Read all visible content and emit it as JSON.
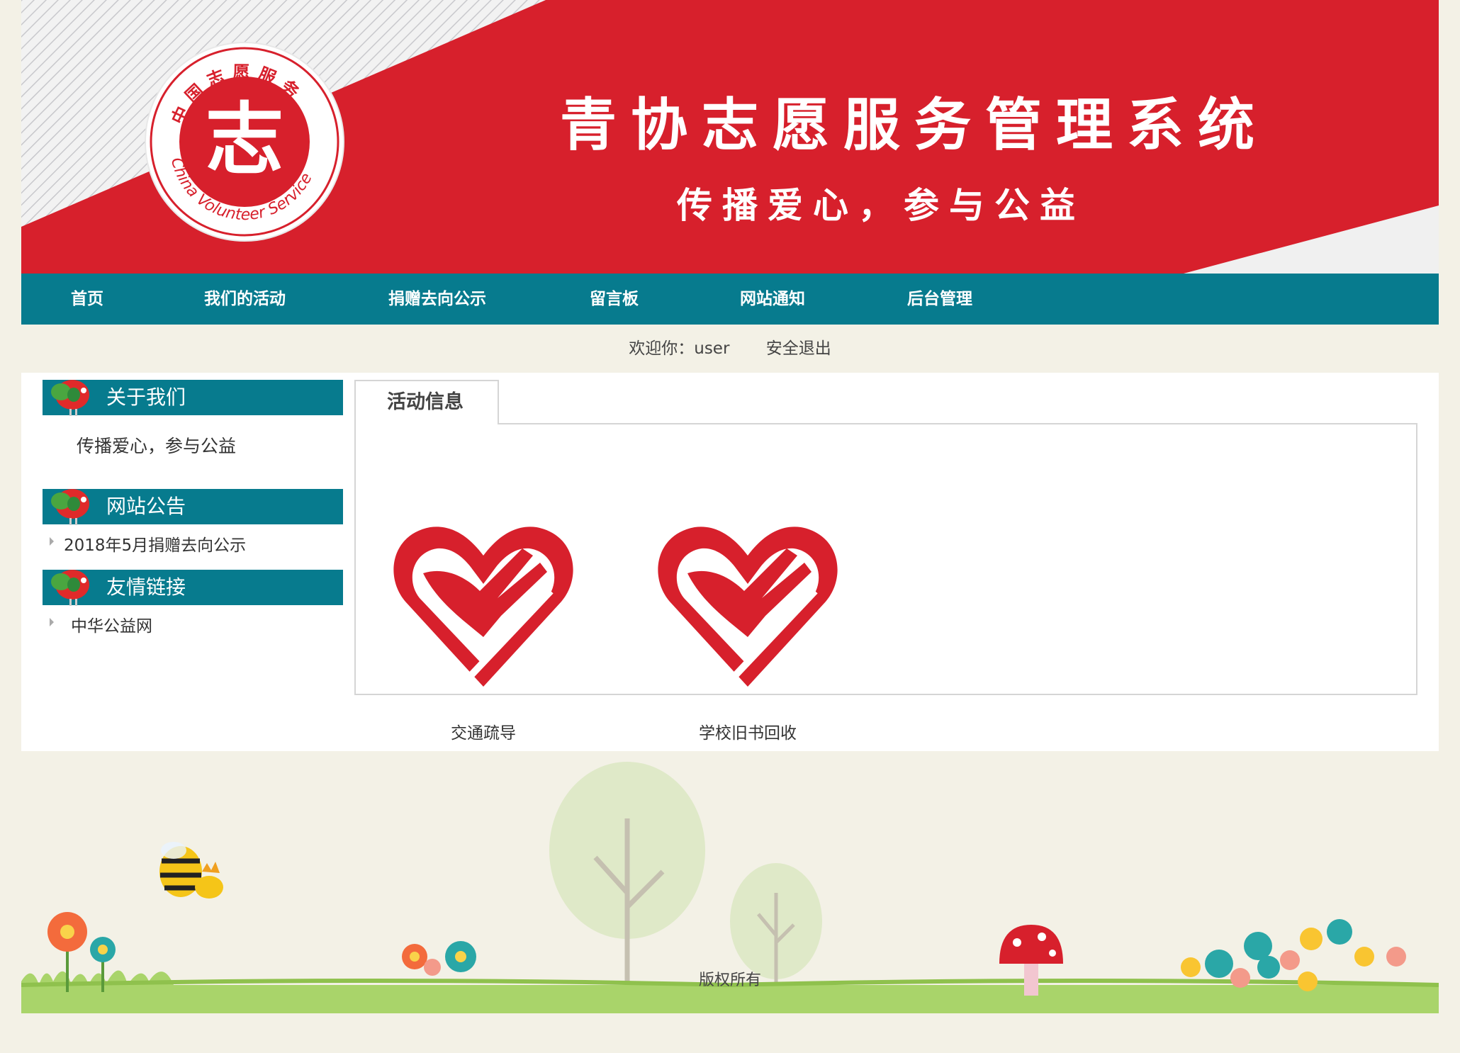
{
  "banner": {
    "title": "青协志愿服务管理系统",
    "slogan": "传播爱心，参与公益",
    "logo_arc_text": "中国志愿服务",
    "logo_english": "China Volunteer Service",
    "logo_char": "志"
  },
  "nav": {
    "items": [
      {
        "label": "首页"
      },
      {
        "label": "我们的活动"
      },
      {
        "label": "捐赠去向公示"
      },
      {
        "label": "留言板"
      },
      {
        "label": "网站通知"
      },
      {
        "label": "后台管理"
      }
    ]
  },
  "welcome": {
    "greeting": "欢迎你：user",
    "logout": "安全退出"
  },
  "sidebar": {
    "about": {
      "title": "关于我们",
      "text": "传播爱心，参与公益"
    },
    "notices": {
      "title": "网站公告",
      "items": [
        "2018年5月捐赠去向公示"
      ]
    },
    "links": {
      "title": "友情链接",
      "items": [
        "中华公益网"
      ]
    }
  },
  "content": {
    "tab_label": "活动信息",
    "activities": [
      {
        "caption": "交通疏导"
      },
      {
        "caption": "学校旧书回收"
      }
    ]
  },
  "footer": {
    "copyright": "版权所有"
  },
  "colors": {
    "brand_red": "#d7202c",
    "nav_teal": "#077b8e",
    "page_bg": "#f3f1e6"
  }
}
